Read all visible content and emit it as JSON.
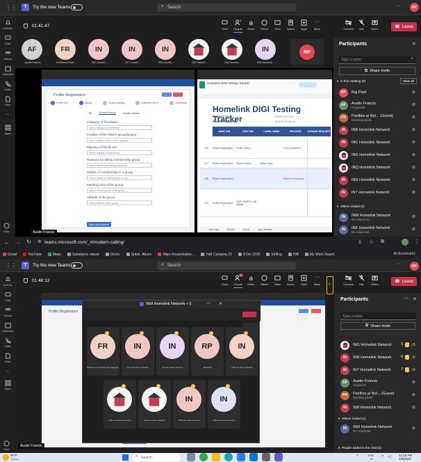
{
  "top_teams": {
    "app_title": "Try the new Teams",
    "search_placeholder": "Search",
    "user_initials": "RP",
    "meeting_time": "01:41:47",
    "toolbar": [
      {
        "label": "Chat",
        "icon": "chat-icon"
      },
      {
        "label": "People",
        "icon": "people-icon",
        "badge": "9"
      },
      {
        "label": "Raise",
        "icon": "raise-hand-icon"
      },
      {
        "label": "React",
        "icon": "react-icon"
      },
      {
        "label": "View",
        "icon": "view-icon"
      },
      {
        "label": "Notes",
        "icon": "notes-icon"
      },
      {
        "label": "Apps",
        "icon": "apps-icon"
      },
      {
        "label": "More",
        "icon": "more-icon"
      }
    ],
    "media": [
      {
        "label": "Camera"
      },
      {
        "label": "Mic"
      },
      {
        "label": "Share"
      }
    ],
    "leave_label": "Leave",
    "rail": [
      "Activity",
      "Chat",
      "Teams",
      "Calendar",
      "Calls",
      "Files",
      "...",
      "Apps",
      "Help"
    ],
    "tiles": [
      {
        "initials": "AF",
        "name": "Austin Francis",
        "color": "#c9d6c9"
      },
      {
        "initials": "FR",
        "name": "Fireflies.ai Note...",
        "color": "#f0d3c4"
      },
      {
        "initials": "IN",
        "name": "INC Homeli...",
        "color": "#f0c7c4"
      },
      {
        "initials": "IN",
        "name": "INT Homeli...",
        "color": "#f0c7c4"
      },
      {
        "initials": "IN",
        "name": "INN Homeli...",
        "color": "#f0c7c4"
      },
      {
        "initials": "",
        "name": "ING Homeli...",
        "color": "#f5f5f5"
      },
      {
        "initials": "",
        "name": "INQ Homelin...",
        "color": "#f5f5f5"
      },
      {
        "initials": "IN",
        "name": "INB Homelink ...",
        "color": "#e8d6f0"
      }
    ],
    "self_initials": "RP",
    "presenter_name": "Austin Francis",
    "participants": {
      "title": "Participants",
      "type_placeholder": "Type a name",
      "share_invite": "Share invite",
      "in_meeting_label": "In this meeting (9)",
      "mute_all": "Mute all",
      "people": [
        {
          "initials": "RP",
          "name": "Raj Parit",
          "sub": "",
          "color": "#e74856"
        },
        {
          "initials": "AF",
          "name": "Austin Francis",
          "sub": "Organizer",
          "color": "#6b8e6b"
        },
        {
          "initials": "FR",
          "name": "Fireflies.ai Not... (Guest)",
          "sub": "Meeting guest",
          "color": "#c46a3c"
        },
        {
          "initials": "IN",
          "name": "INB Homelink Network",
          "sub": "",
          "color": "#c43c54"
        },
        {
          "initials": "IN",
          "name": "INC Homelink Network",
          "sub": "",
          "color": "#c43c54"
        },
        {
          "initials": "",
          "name": "ING Homelink Network",
          "sub": "",
          "color": "#eeeeee"
        },
        {
          "initials": "",
          "name": "INQ Homelink Network",
          "sub": "",
          "color": "#eeeeee"
        },
        {
          "initials": "IN",
          "name": "INN Homelink Network",
          "sub": "",
          "color": "#c43c54"
        },
        {
          "initials": "IN",
          "name": "INT Homelink Network",
          "sub": "",
          "color": "#c43c54"
        }
      ],
      "others_label": "Others invited (2)",
      "others": [
        {
          "initials": "IN",
          "name": "INM Homelink Network",
          "sub": "No response",
          "color": "#5a6a9a"
        },
        {
          "initials": "IN",
          "name": "INK Homelink Network",
          "sub": "No response",
          "color": "#5a6a9a"
        }
      ]
    },
    "shared": {
      "left_tab": "Profile Registration",
      "form_title": "Profile Registration",
      "steps": [
        "Profile Det...",
        "Eating...",
        "Social Investig...",
        "Extended Info F...",
        "Comments"
      ],
      "tabs": [
        "Tie",
        "Social History",
        "Health details"
      ],
      "fields": [
        {
          "label": "Category of friendship",
          "value": "Select category of friendship"
        },
        {
          "label": "Position of the child in group/league",
          "value": "Select position of the child in group/l"
        },
        {
          "label": "Majority of friends are",
          "value": "Select majority of friends are"
        },
        {
          "label": "Reasons for taking membership group",
          "value": "Select reasons for taking members..."
        },
        {
          "label": "Details of membership in a group",
          "value": "Select details of membership in a gr..."
        },
        {
          "label": "Meeting point of the group",
          "value": "Select meeting point of the group"
        },
        {
          "label": "Attitude of the group",
          "value": "Select attitude of the group"
        }
      ],
      "save_button": "Save and continue",
      "sheet_title": "Homelink DIGI Testing Tracker",
      "sheet_tab": "Homelink DIGI Testing Tracker",
      "project_title": "PROJECT TITLE",
      "project_manager": "PROJECT MANAGER",
      "project_title_val": "HOMELINK DIGI",
      "project_manager_val": "AUSTIN FRANCIS",
      "headers": [
        "MAIN TAB",
        "SUB TAB",
        "LABEL NAME",
        "PROCESS",
        "CHANGE REQUEST"
      ],
      "rows": [
        {
          "num": "226",
          "main": "Profile Registration",
          "sub": "Profile Status",
          "label": "",
          "process": "Final Settlement"
        },
        {
          "num": "227",
          "main": "Profile Registration",
          "sub": "Social History",
          "label": "Status Type",
          "process": ""
        },
        {
          "num": "228",
          "main": "Profile Registration",
          "sub": "",
          "label": "",
          "process": "Move it to Services"
        },
        {
          "num": "229",
          "main": "Profile Registration",
          "sub": "OMG SUPPLY LIB details",
          "label": "",
          "process": ""
        }
      ],
      "sheet_tabs": [
        "Test Data",
        "Sheet4",
        "Event",
        "Apps Monitor"
      ]
    }
  },
  "browser": {
    "url": "teams.microsoft.com/_#/modern-calling/",
    "bookmarks": [
      "Gmail",
      "YouTube",
      "Maps",
      "Substance abuse",
      "Vector",
      "Subst. Abuse",
      "https://examination...",
      "YaB Camping 23",
      "8 Oct 2015",
      "Strfling",
      "HiB",
      "My Work Report"
    ],
    "all_bookmarks": "All Bookmarks"
  },
  "bottom_teams": {
    "app_title": "Try the new Teams",
    "search_placeholder": "Search",
    "user_initials": "RP",
    "meeting_time": "01:48:12",
    "people_badge": "10",
    "leave_label": "Leave",
    "popup_title": "INM Homelink Network + 5",
    "popup_tiles": [
      {
        "initials": "FR",
        "name": "Fireflies.ai Notetaker Raj Raja@Jd...",
        "color": "#f0d3c4"
      },
      {
        "initials": "IN",
        "name": "INC Homelink Network",
        "color": "#f0c7c4"
      },
      {
        "initials": "IN",
        "name": "INT Homelink Network",
        "color": "#e8d6f0"
      },
      {
        "initials": "RP",
        "name": "Raj Parit",
        "color": "#f0c7c4"
      },
      {
        "initials": "IN",
        "name": "INB Homelink Network",
        "color": "#f0d3c4"
      },
      {
        "initials": "",
        "name": "ING Homelink Network",
        "color": "#f5f5f5"
      },
      {
        "initials": "",
        "name": "INQ Homelink Network",
        "color": "#f5f5f5"
      },
      {
        "initials": "IN",
        "name": "INN Homelink Network",
        "color": "#f0c7c4"
      },
      {
        "initials": "IN",
        "name": "INM Homelink Network",
        "color": "#dde3f5"
      }
    ],
    "popup_self": "AF",
    "participants": {
      "title": "Participants",
      "type_placeholder": "Type a name",
      "share_invite": "Share invite",
      "people": [
        {
          "initials": "",
          "name": "ING Homelink Network",
          "sub": "",
          "color": "#eeeeee",
          "hand": "5"
        },
        {
          "initials": "IN",
          "name": "INN Homelink Network",
          "sub": "",
          "color": "#c43c54",
          "hand": "6"
        },
        {
          "initials": "IN",
          "name": "INT Homelink Network",
          "sub": "",
          "color": "#c43c54",
          "hand": "7"
        },
        {
          "initials": "AF",
          "name": "Austin Francis",
          "sub": "Organizer",
          "color": "#6b8e6b",
          "hand": ""
        },
        {
          "initials": "FR",
          "name": "Fireflies.ai Not... (Guest)",
          "sub": "Meeting guest",
          "color": "#c46a3c",
          "hand": ""
        },
        {
          "initials": "IN",
          "name": "INB Homelink Network",
          "sub": "",
          "color": "#c43c54",
          "hand": ""
        }
      ],
      "others_label": "Others invited (1)",
      "others": [
        {
          "initials": "IN",
          "name": "INM Homelink Network",
          "sub": "No response",
          "color": "#5a6a9a"
        }
      ],
      "added_label": "People added to the chat (1)"
    },
    "form_bottom_label": "Attitude of the group",
    "form_bottom_value": "Select attitude of the group",
    "save_button": "Save and continue",
    "presenter_name": "Austin Francis"
  },
  "taskbar": {
    "weather_temp": "95°F",
    "weather_text": "Sunny",
    "search_placeholder": "Search",
    "lang": "ENG",
    "lang2": "IN",
    "time": "12:15 PM",
    "date": "4/9/2024"
  }
}
